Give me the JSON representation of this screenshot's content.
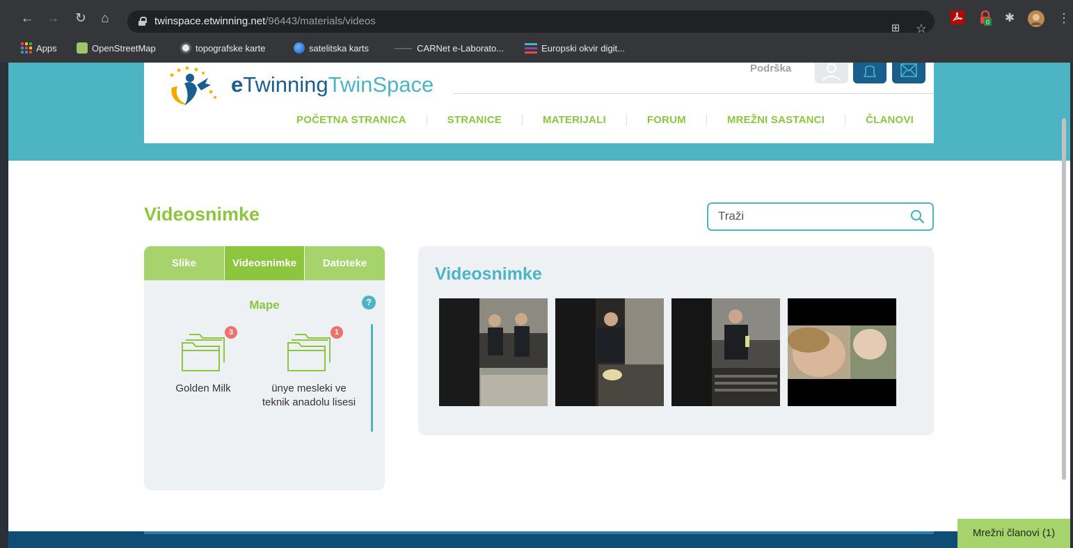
{
  "browser": {
    "url_host": "twinspace.etwinning.net",
    "url_path": "/96443/materials/videos",
    "bookmarks": [
      {
        "label": "Apps",
        "icon": "apps-grid-icon"
      },
      {
        "label": "OpenStreetMap",
        "icon": "openstreetmap-icon"
      },
      {
        "label": "topografske karte",
        "icon": "globe-icon"
      },
      {
        "label": "satelitska karts",
        "icon": "earth-icon"
      },
      {
        "label": "CARNet e-Laborato...",
        "icon": "carnet-icon"
      },
      {
        "label": "Europski okvir digit...",
        "icon": "menu-lines-icon"
      }
    ],
    "extension_badge": "0"
  },
  "header": {
    "logo_e": "e",
    "logo_twinning": "Twinning",
    "logo_twinspace": "TwinSpace",
    "support_label": "Podrška",
    "nav": [
      "POČETNA STRANICA",
      "STRANICE",
      "MATERIJALI",
      "FORUM",
      "MREŽNI SASTANCI",
      "ČLANOVI"
    ]
  },
  "page": {
    "title": "Videosnimke",
    "search_placeholder": "Traži"
  },
  "left_panel": {
    "tabs": [
      {
        "label": "Slike",
        "active": false
      },
      {
        "label": "Videosnimke",
        "active": true
      },
      {
        "label": "Datoteke",
        "active": false
      }
    ],
    "folders_heading": "Mape",
    "help_symbol": "?",
    "folders": [
      {
        "name": "Golden Milk",
        "count": "3"
      },
      {
        "name": "ünye mesleki ve teknik anadolu lisesi",
        "count": "1"
      }
    ]
  },
  "videos_panel": {
    "title": "Videosnimke",
    "thumbnails": [
      "video-thumbnail-1",
      "video-thumbnail-2",
      "video-thumbnail-3",
      "video-thumbnail-4"
    ]
  },
  "chat": {
    "online_members_label": "Mrežni članovi (1)"
  },
  "colors": {
    "teal": "#4db4c3",
    "green": "#8cc63f",
    "navy": "#0f4d74",
    "badge_red": "#f0716b"
  }
}
